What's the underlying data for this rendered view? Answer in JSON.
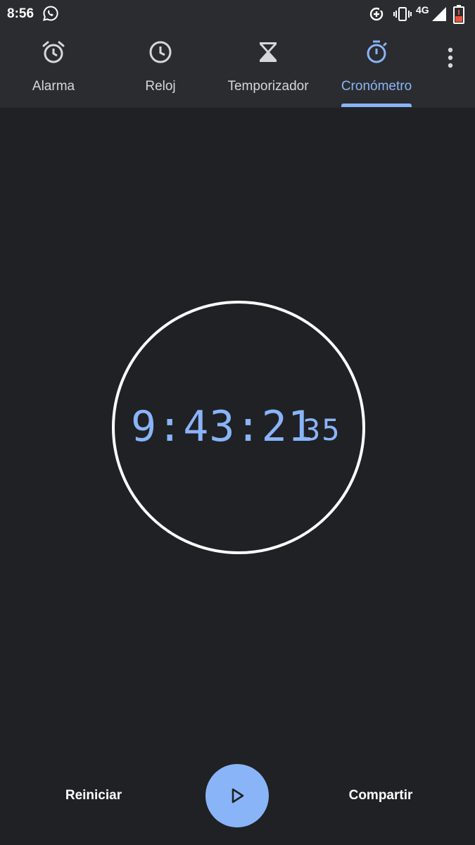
{
  "status_bar": {
    "time": "8:56",
    "network": "4G",
    "icons": [
      "whatsapp-icon",
      "data-saver-icon",
      "vibrate-icon",
      "signal-icon",
      "battery-low-icon"
    ]
  },
  "tabs": [
    {
      "label": "Alarma",
      "icon": "alarm-icon",
      "active": false
    },
    {
      "label": "Reloj",
      "icon": "clock-icon",
      "active": false
    },
    {
      "label": "Temporizador",
      "icon": "hourglass-icon",
      "active": false
    },
    {
      "label": "Cronómetro",
      "icon": "stopwatch-icon",
      "active": true
    }
  ],
  "overflow_menu": {
    "icon": "more-vert-icon"
  },
  "stopwatch": {
    "elapsed": "9:43:21",
    "hundredths": "35"
  },
  "actions": {
    "reset_label": "Reiniciar",
    "share_label": "Compartir",
    "play_icon": "play-icon"
  },
  "colors": {
    "background": "#202124",
    "bar_background": "#2b2c2f",
    "accent": "#8ab4f8",
    "text": "#ffffff",
    "tab_inactive": "#d6d7da",
    "battery_low": "#e8513c"
  }
}
